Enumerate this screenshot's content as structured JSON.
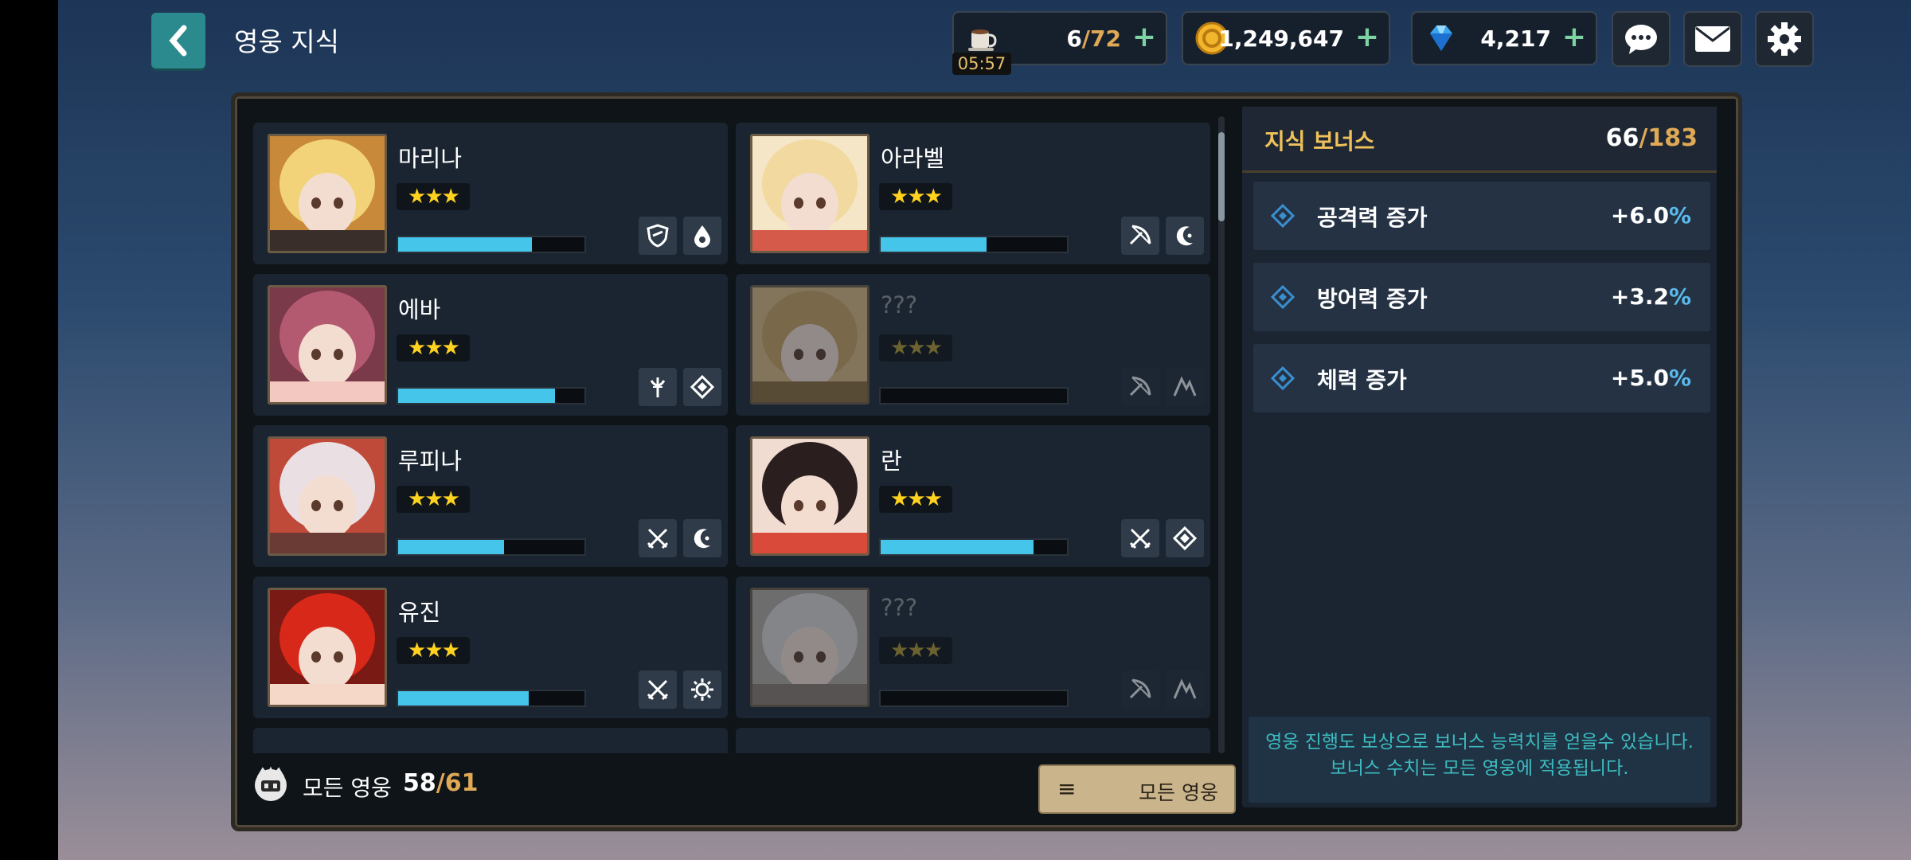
{
  "header": {
    "title": "영웅 지식",
    "stamina": {
      "current": "6",
      "max": "72",
      "timer": "05:57"
    },
    "gold": "1,249,647",
    "gems": "4,217",
    "plus": "+"
  },
  "heroes": [
    {
      "name": "마리나",
      "stars": "★★★",
      "progress": 0.72,
      "icons": [
        "shield-class-icon",
        "water-element-icon"
      ],
      "locked": false
    },
    {
      "name": "아라벨",
      "stars": "★★★",
      "progress": 0.57,
      "icons": [
        "bow-class-icon",
        "moon-element-icon"
      ],
      "locked": false
    },
    {
      "name": "에바",
      "stars": "★★★",
      "progress": 0.84,
      "icons": [
        "staff-class-icon",
        "diamond-element-icon"
      ],
      "locked": false
    },
    {
      "name": "???",
      "stars": "★★★",
      "progress": 0,
      "icons": [
        "bow-class-icon",
        "mountain-element-icon"
      ],
      "locked": true
    },
    {
      "name": "루피나",
      "stars": "★★★",
      "progress": 0.57,
      "icons": [
        "swords-class-icon",
        "moon-element-icon"
      ],
      "locked": false
    },
    {
      "name": "란",
      "stars": "★★★",
      "progress": 0.82,
      "icons": [
        "swords-class-icon",
        "diamond-element-icon"
      ],
      "locked": false
    },
    {
      "name": "유진",
      "stars": "★★★",
      "progress": 0.7,
      "icons": [
        "swords-class-icon",
        "sun-element-icon"
      ],
      "locked": false
    },
    {
      "name": "???",
      "stars": "★★★",
      "progress": 0,
      "icons": [
        "bow-class-icon",
        "mountain-element-icon"
      ],
      "locked": true
    }
  ],
  "footer": {
    "label": "모든 영웅",
    "count": "58",
    "total": "/61",
    "filter_label": "모든 영웅",
    "menu_glyph": "≡"
  },
  "bonus": {
    "title": "지식 보너스",
    "count": "66",
    "total": "/183",
    "stats": [
      {
        "label": "공격력 증가",
        "value": "+6.0",
        "unit": "%"
      },
      {
        "label": "방어력 증가",
        "value": "+3.2",
        "unit": "%"
      },
      {
        "label": "체력 증가",
        "value": "+5.0",
        "unit": "%"
      }
    ],
    "info_line1": "영웅 진행도 보상으로 보너스 능력치를 얻을수 있습니다.",
    "info_line2": "보너스 수치는 모든 영웅에 적용됩니다."
  },
  "colors": {
    "accent": "#46c5eb",
    "gold": "#e0a955",
    "teal": "#2a8a8d"
  }
}
